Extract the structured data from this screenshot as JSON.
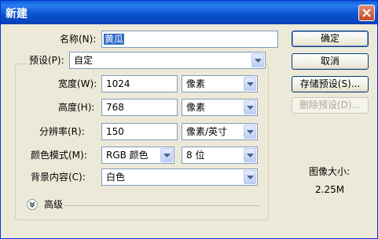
{
  "window": {
    "title": "新建"
  },
  "form": {
    "name_label": "名称(N):",
    "name_value": "黄瓜",
    "preset_label": "预设(P):",
    "preset_value": "自定",
    "width_label": "宽度(W):",
    "width_value": "1024",
    "width_unit": "像素",
    "height_label": "高度(H):",
    "height_value": "768",
    "height_unit": "像素",
    "resolution_label": "分辨率(R):",
    "resolution_value": "150",
    "resolution_unit": "像素/英寸",
    "color_mode_label": "颜色模式(M):",
    "color_mode_value": "RGB 颜色",
    "bit_depth_value": "8 位",
    "background_label": "背景内容(C):",
    "background_value": "白色",
    "advanced_label": "高级"
  },
  "buttons": {
    "ok": "确定",
    "cancel": "取消",
    "save_preset": "存储预设(S)...",
    "delete_preset": "删除预设(D)..."
  },
  "image_size": {
    "label": "图像大小:",
    "value": "2.25M"
  }
}
